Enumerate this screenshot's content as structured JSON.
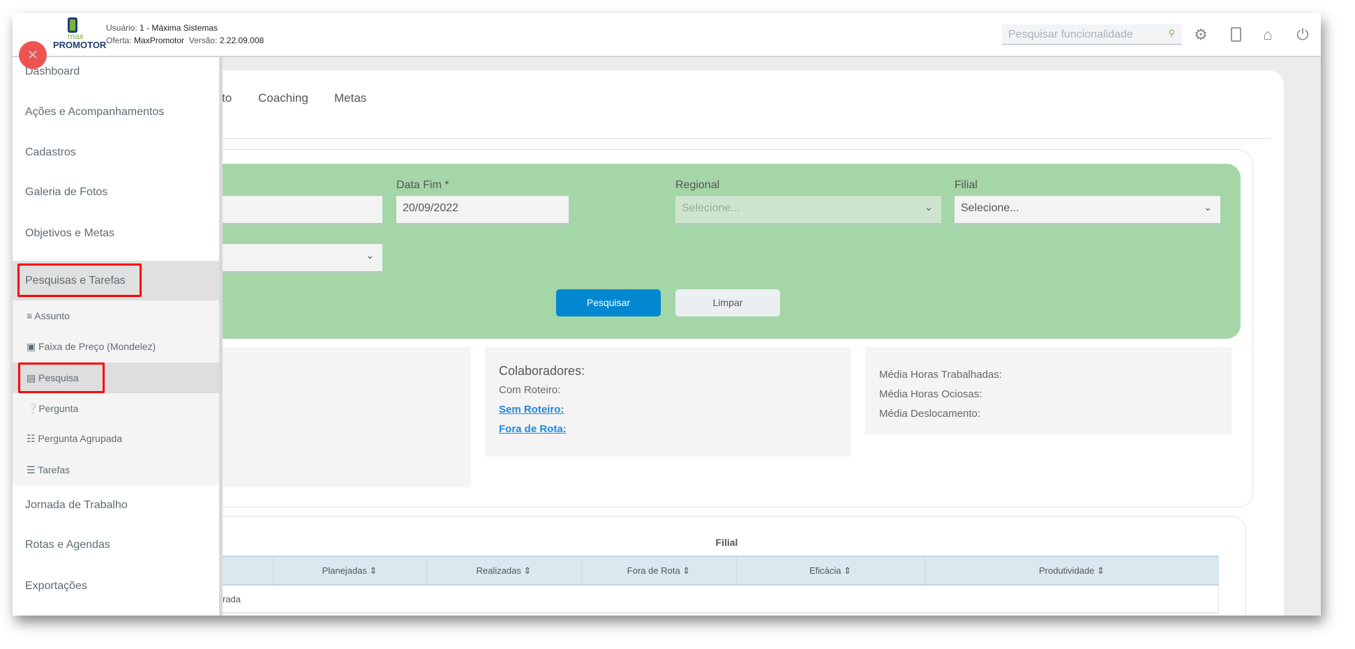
{
  "header": {
    "user_label": "Usuário:",
    "user_value": "1 - Máxima Sistemas",
    "offer_label": "Oferta:",
    "offer_value": "MaxPromotor",
    "version_label": "Versão:",
    "version_value": "2.22.09.008",
    "logo_small": "max",
    "logo_big": "PROMOTOR",
    "search_placeholder": "Pesquisar funcionalidade"
  },
  "tabs": [
    "to",
    "Coaching",
    "Metas"
  ],
  "filters": {
    "data_fim_label": "Data Fim *",
    "data_fim_value": "20/09/2022",
    "regional_label": "Regional",
    "regional_value": "Selecione...",
    "filial_label": "Filial",
    "filial_value": "Selecione...",
    "search_button": "Pesquisar",
    "clear_button": "Limpar"
  },
  "stats": {
    "colaboradores": "Colaboradores:",
    "com_roteiro": "Com Roteiro:",
    "sem_roteiro": "Sem Roteiro:",
    "fora_de_rota": "Fora de Rota:",
    "media_trabalhadas": "Média Horas Trabalhadas:",
    "media_ociosas": "Média Horas Ociosas:",
    "media_deslocamento": "Média Deslocamento:"
  },
  "table": {
    "title": "Filial",
    "columns": [
      "Planejadas",
      "Realizadas",
      "Fora de Rota",
      "Eficácia",
      "Produtividade"
    ],
    "empty_text": "rada"
  },
  "sidebar": {
    "items": [
      "Dashboard",
      "Ações e Acompanhamentos",
      "Cadastros",
      "Galeria de Fotos",
      "Objetivos e Metas",
      "Pesquisas e Tarefas",
      "Jornada de Trabalho",
      "Rotas e Agendas",
      "Exportações"
    ],
    "subitems": [
      "Assunto",
      "Faixa de Preço (Mondelez)",
      "Pesquisa",
      "Pergunta",
      "Pergunta Agrupada",
      "Tarefas"
    ]
  },
  "colors": {
    "green": "#a5d6a7",
    "primary": "#0288d1",
    "close": "#ef5350",
    "highlight": "#ff0000"
  }
}
